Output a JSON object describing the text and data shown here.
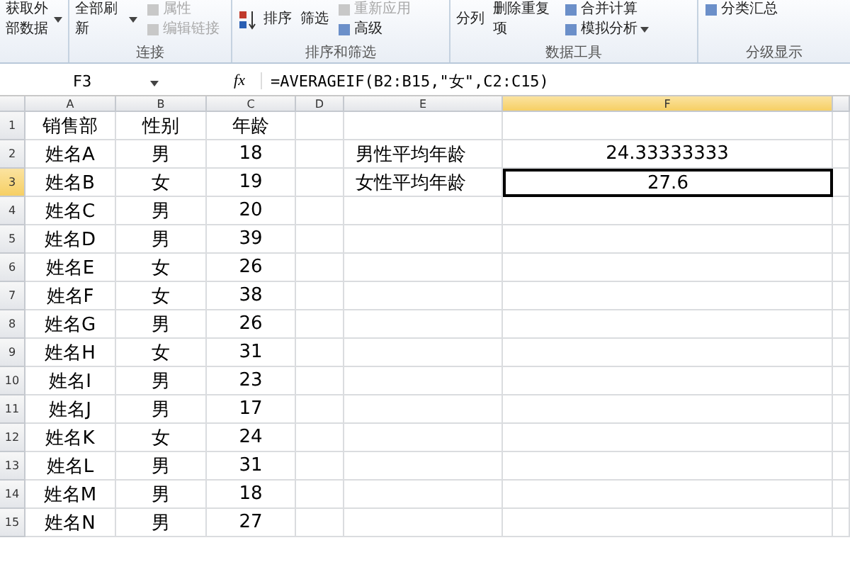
{
  "ribbon": {
    "groups": [
      {
        "items": [
          {
            "label": "获取外部数据",
            "kind": "large",
            "dropdown": true,
            "disabled": false
          }
        ]
      },
      {
        "label": "连接",
        "items": [
          {
            "label": "全部刷新",
            "kind": "large",
            "dropdown": true,
            "disabled": false
          },
          {
            "label": "属性",
            "kind": "small",
            "dropdown": false,
            "disabled": true
          },
          {
            "label": "编辑链接",
            "kind": "small",
            "dropdown": false,
            "disabled": true
          }
        ]
      },
      {
        "label": "排序和筛选",
        "items": [
          {
            "label": "排序",
            "kind": "sort",
            "dropdown": false,
            "disabled": false
          },
          {
            "label": "筛选",
            "kind": "large",
            "dropdown": false,
            "disabled": false
          },
          {
            "label": "重新应用",
            "kind": "small",
            "dropdown": false,
            "disabled": true
          },
          {
            "label": "高级",
            "kind": "small",
            "dropdown": false,
            "disabled": false
          }
        ]
      },
      {
        "label": "数据工具",
        "items": [
          {
            "label": "分列",
            "kind": "large",
            "dropdown": false,
            "disabled": false
          },
          {
            "label": "删除重复项",
            "kind": "large",
            "dropdown": false,
            "disabled": false
          },
          {
            "label": "合并计算",
            "kind": "small",
            "dropdown": false,
            "disabled": false
          },
          {
            "label": "模拟分析",
            "kind": "small",
            "dropdown": true,
            "disabled": false
          }
        ]
      },
      {
        "label": "分级显示",
        "items": [
          {
            "label": "分类汇总",
            "kind": "small",
            "dropdown": false,
            "disabled": false
          }
        ]
      }
    ]
  },
  "name_box": "F3",
  "fx_label": "fx",
  "formula": "=AVERAGEIF(B2:B15,\"女\",C2:C15)",
  "columns": [
    {
      "label": "A",
      "selected": false
    },
    {
      "label": "B",
      "selected": false
    },
    {
      "label": "C",
      "selected": false
    },
    {
      "label": "D",
      "selected": false
    },
    {
      "label": "E",
      "selected": false
    },
    {
      "label": "F",
      "selected": true
    }
  ],
  "rows": [
    {
      "number": "1",
      "selected": false,
      "cells": [
        {
          "text": "销售部",
          "selected": false
        },
        {
          "text": "性别",
          "selected": false
        },
        {
          "text": "年龄",
          "selected": false
        },
        null,
        null,
        null
      ]
    },
    {
      "number": "2",
      "selected": false,
      "cells": [
        {
          "text": "姓名A",
          "selected": false
        },
        {
          "text": "男",
          "selected": false
        },
        {
          "text": "18",
          "selected": false
        },
        null,
        {
          "text": "男性平均年龄",
          "selected": false
        },
        {
          "text": "24.33333333",
          "selected": false
        }
      ]
    },
    {
      "number": "3",
      "selected": true,
      "cells": [
        {
          "text": "姓名B",
          "selected": false
        },
        {
          "text": "女",
          "selected": false
        },
        {
          "text": "19",
          "selected": false
        },
        null,
        {
          "text": "女性平均年龄",
          "selected": false
        },
        {
          "text": "27.6",
          "selected": true
        }
      ]
    },
    {
      "number": "4",
      "selected": false,
      "cells": [
        {
          "text": "姓名C",
          "selected": false
        },
        {
          "text": "男",
          "selected": false
        },
        {
          "text": "20",
          "selected": false
        },
        null,
        null,
        null
      ]
    },
    {
      "number": "5",
      "selected": false,
      "cells": [
        {
          "text": "姓名D",
          "selected": false
        },
        {
          "text": "男",
          "selected": false
        },
        {
          "text": "39",
          "selected": false
        },
        null,
        null,
        null
      ]
    },
    {
      "number": "6",
      "selected": false,
      "cells": [
        {
          "text": "姓名E",
          "selected": false
        },
        {
          "text": "女",
          "selected": false
        },
        {
          "text": "26",
          "selected": false
        },
        null,
        null,
        null
      ]
    },
    {
      "number": "7",
      "selected": false,
      "cells": [
        {
          "text": "姓名F",
          "selected": false
        },
        {
          "text": "女",
          "selected": false
        },
        {
          "text": "38",
          "selected": false
        },
        null,
        null,
        null
      ]
    },
    {
      "number": "8",
      "selected": false,
      "cells": [
        {
          "text": "姓名G",
          "selected": false
        },
        {
          "text": "男",
          "selected": false
        },
        {
          "text": "26",
          "selected": false
        },
        null,
        null,
        null
      ]
    },
    {
      "number": "9",
      "selected": false,
      "cells": [
        {
          "text": "姓名H",
          "selected": false
        },
        {
          "text": "女",
          "selected": false
        },
        {
          "text": "31",
          "selected": false
        },
        null,
        null,
        null
      ]
    },
    {
      "number": "10",
      "selected": false,
      "cells": [
        {
          "text": "姓名I",
          "selected": false
        },
        {
          "text": "男",
          "selected": false
        },
        {
          "text": "23",
          "selected": false
        },
        null,
        null,
        null
      ]
    },
    {
      "number": "11",
      "selected": false,
      "cells": [
        {
          "text": "姓名J",
          "selected": false
        },
        {
          "text": "男",
          "selected": false
        },
        {
          "text": "17",
          "selected": false
        },
        null,
        null,
        null
      ]
    },
    {
      "number": "12",
      "selected": false,
      "cells": [
        {
          "text": "姓名K",
          "selected": false
        },
        {
          "text": "女",
          "selected": false
        },
        {
          "text": "24",
          "selected": false
        },
        null,
        null,
        null
      ]
    },
    {
      "number": "13",
      "selected": false,
      "cells": [
        {
          "text": "姓名L",
          "selected": false
        },
        {
          "text": "男",
          "selected": false
        },
        {
          "text": "31",
          "selected": false
        },
        null,
        null,
        null
      ]
    },
    {
      "number": "14",
      "selected": false,
      "cells": [
        {
          "text": "姓名M",
          "selected": false
        },
        {
          "text": "男",
          "selected": false
        },
        {
          "text": "18",
          "selected": false
        },
        null,
        null,
        null
      ]
    },
    {
      "number": "15",
      "selected": false,
      "cells": [
        {
          "text": "姓名N",
          "selected": false
        },
        {
          "text": "男",
          "selected": false
        },
        {
          "text": "27",
          "selected": false
        },
        null,
        null,
        null
      ]
    }
  ]
}
